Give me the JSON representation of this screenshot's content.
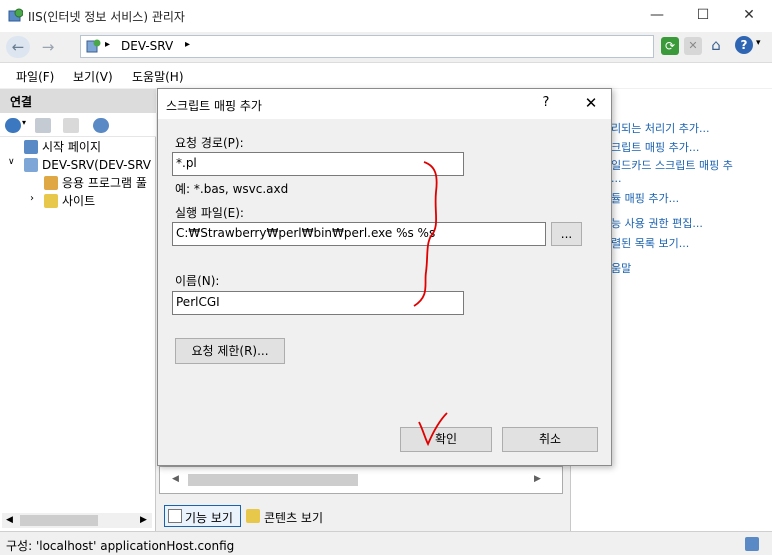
{
  "window": {
    "title": "IIS(인터넷 정보 서비스) 관리자",
    "minimize": "—",
    "maximize": "☐",
    "close": "✕"
  },
  "address": {
    "path": "DEV-SRV"
  },
  "menu": {
    "file": "파일(F)",
    "view": "보기(V)",
    "help": "도움말(H)"
  },
  "connections": {
    "header": "연결",
    "tree": [
      {
        "label": "시작 페이지"
      },
      {
        "label": "DEV-SRV(DEV-SRV"
      },
      {
        "label": "응용 프로그램 풀"
      },
      {
        "label": "사이트"
      }
    ]
  },
  "actions": {
    "items": [
      {
        "label": "리되는 처리기 추가..."
      },
      {
        "label": "크립트 매핑 추가..."
      },
      {
        "label": "일드카드 스크립트 매핑 추"
      },
      {
        "label": "..."
      },
      {
        "label": "듈 매핑 추가..."
      },
      {
        "label": "능 사용 권한 편집..."
      },
      {
        "label": "렬된 목록 보기..."
      },
      {
        "label": "움말"
      }
    ]
  },
  "bottom_tabs": {
    "features_view": "기능 보기",
    "content_view": "콘텐츠 보기"
  },
  "status": {
    "text": "구성: 'localhost' applicationHost.config"
  },
  "dialog": {
    "title": "스크립트 매핑 추가",
    "help_glyph": "?",
    "close_glyph": "✕",
    "request_path_label": "요청 경로(P):",
    "request_path_value": "*.pl",
    "example_text": "예: *.bas, wsvc.axd",
    "executable_label": "실행 파일(E):",
    "executable_value": "C:₩Strawberry₩perl₩bin₩perl.exe %s %s",
    "browse_label": "...",
    "name_label": "이름(N):",
    "name_value": "PerlCGI",
    "restrictions_button": "요청 제한(R)...",
    "ok_button": "확인",
    "cancel_button": "취소"
  },
  "colors": {
    "accent_link": "#1a62b0",
    "annotation_red": "#e00000"
  }
}
